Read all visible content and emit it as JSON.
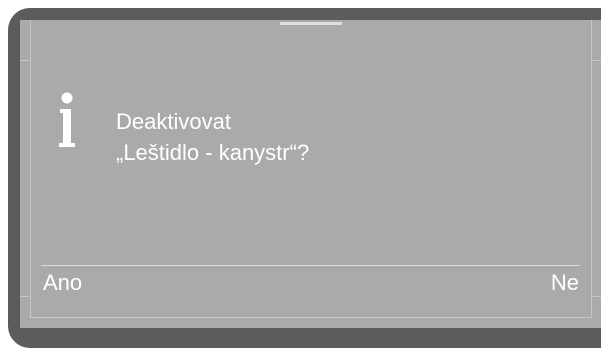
{
  "dialog": {
    "icon": "info-icon",
    "message_line1": "Deaktivovat",
    "message_line2": "„Leštidlo - kanystr“?"
  },
  "softkeys": {
    "left_label": "Ano",
    "right_label": "Ne"
  },
  "colors": {
    "bezel": "#5c5c5c",
    "screen": "#aaaaaa",
    "text": "#ffffff",
    "frame_lines": "#c8c8c8"
  }
}
